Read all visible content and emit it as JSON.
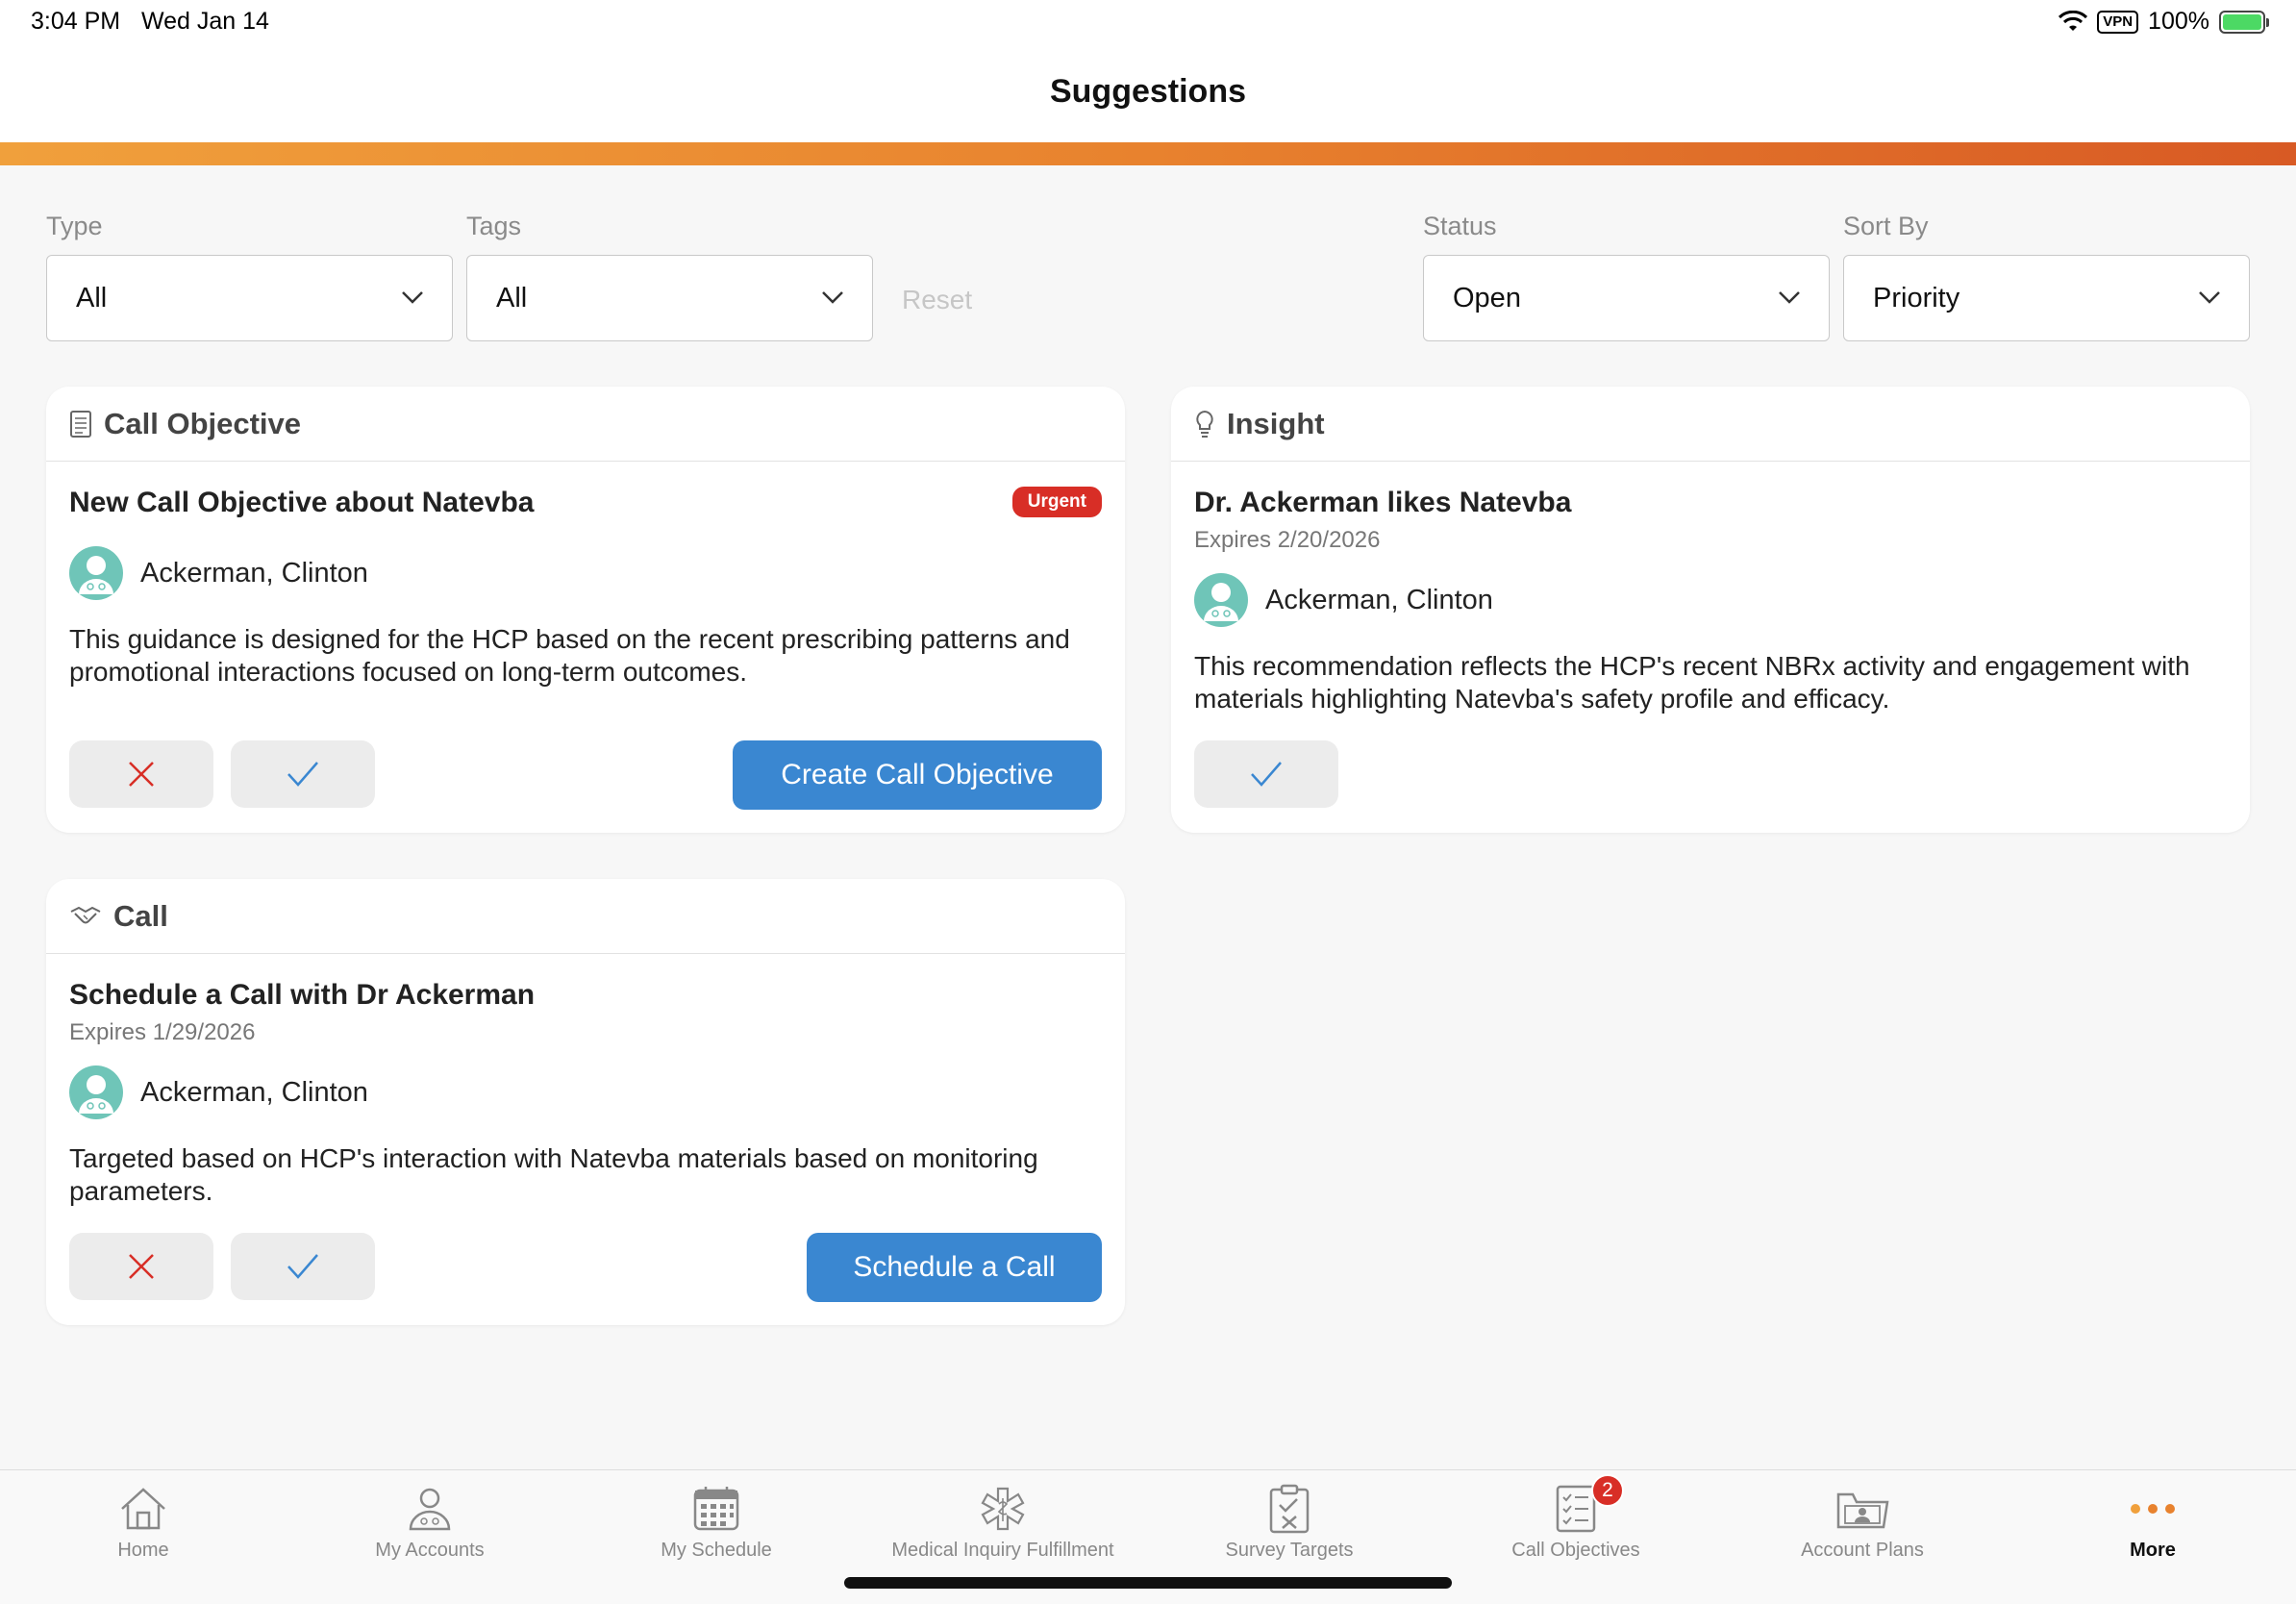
{
  "status_bar": {
    "time": "3:04 PM",
    "date": "Wed Jan 14",
    "vpn": "VPN",
    "battery": "100%"
  },
  "header": {
    "title": "Suggestions"
  },
  "filters": {
    "type": {
      "label": "Type",
      "value": "All"
    },
    "tags": {
      "label": "Tags",
      "value": "All"
    },
    "reset": "Reset",
    "status": {
      "label": "Status",
      "value": "Open"
    },
    "sort_by": {
      "label": "Sort By",
      "value": "Priority"
    }
  },
  "cards": {
    "call_objective": {
      "header": "Call Objective",
      "title": "New Call Objective about Natevba",
      "badge": "Urgent",
      "person": "Ackerman, Clinton",
      "description": "This guidance is designed for the HCP based on the recent prescribing patterns and promotional interactions focused on long-term outcomes.",
      "action": "Create Call Objective"
    },
    "insight": {
      "header": "Insight",
      "title": "Dr. Ackerman likes Natevba",
      "expires": "Expires 2/20/2026",
      "person": "Ackerman, Clinton",
      "description": "This recommendation reflects the HCP's recent NBRx activity and engagement with materials highlighting Natevba's safety profile and efficacy."
    },
    "call": {
      "header": "Call",
      "title": "Schedule a Call with Dr Ackerman",
      "expires": "Expires 1/29/2026",
      "person": "Ackerman, Clinton",
      "description": "Targeted based on HCP's interaction with Natevba materials based on monitoring parameters.",
      "action": "Schedule a Call"
    }
  },
  "tabs": [
    {
      "label": "Home",
      "icon": "home-icon"
    },
    {
      "label": "My Accounts",
      "icon": "accounts-icon"
    },
    {
      "label": "My Schedule",
      "icon": "calendar-icon"
    },
    {
      "label": "Medical Inquiry Fulfillment",
      "icon": "medical-icon"
    },
    {
      "label": "Survey Targets",
      "icon": "clipboard-icon"
    },
    {
      "label": "Call Objectives",
      "icon": "checklist-icon",
      "badge": "2"
    },
    {
      "label": "Account Plans",
      "icon": "folder-icon"
    },
    {
      "label": "More",
      "icon": "more-icon",
      "active": true
    }
  ],
  "colors": {
    "accent_start": "#f0a03c",
    "accent_end": "#d85a24",
    "primary": "#3a87d1",
    "urgent": "#d82e26",
    "dismiss": "#d82e26",
    "accept": "#3a87d1"
  }
}
